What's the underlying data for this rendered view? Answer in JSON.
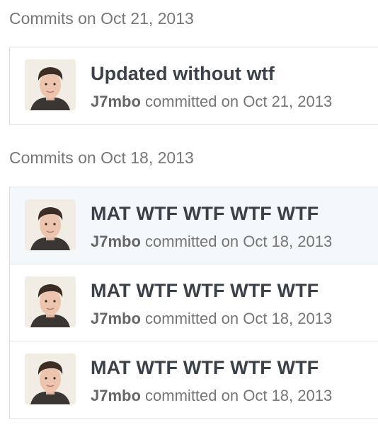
{
  "groups": [
    {
      "heading": "Commits on Oct 21, 2013",
      "commits": [
        {
          "title": "Updated without wtf",
          "author": "J7mbo",
          "verb": "committed on",
          "date": "Oct 21, 2013",
          "avatar_icon": "user-avatar-icon"
        }
      ]
    },
    {
      "heading": "Commits on Oct 18, 2013",
      "commits": [
        {
          "title": "MAT WTF WTF WTF WTF",
          "author": "J7mbo",
          "verb": "committed on",
          "date": "Oct 18, 2013",
          "avatar_icon": "user-avatar-icon"
        },
        {
          "title": "MAT WTF WTF WTF WTF",
          "author": "J7mbo",
          "verb": "committed on",
          "date": "Oct 18, 2013",
          "avatar_icon": "user-avatar-icon"
        },
        {
          "title": "MAT WTF WTF WTF WTF",
          "author": "J7mbo",
          "verb": "committed on",
          "date": "Oct 18, 2013",
          "avatar_icon": "user-avatar-icon"
        }
      ]
    }
  ],
  "colors": {
    "heading": "#767676",
    "title": "#3b4148",
    "meta": "#767676",
    "highlight_row": "#f5f8fa",
    "border": "#dddddd"
  }
}
